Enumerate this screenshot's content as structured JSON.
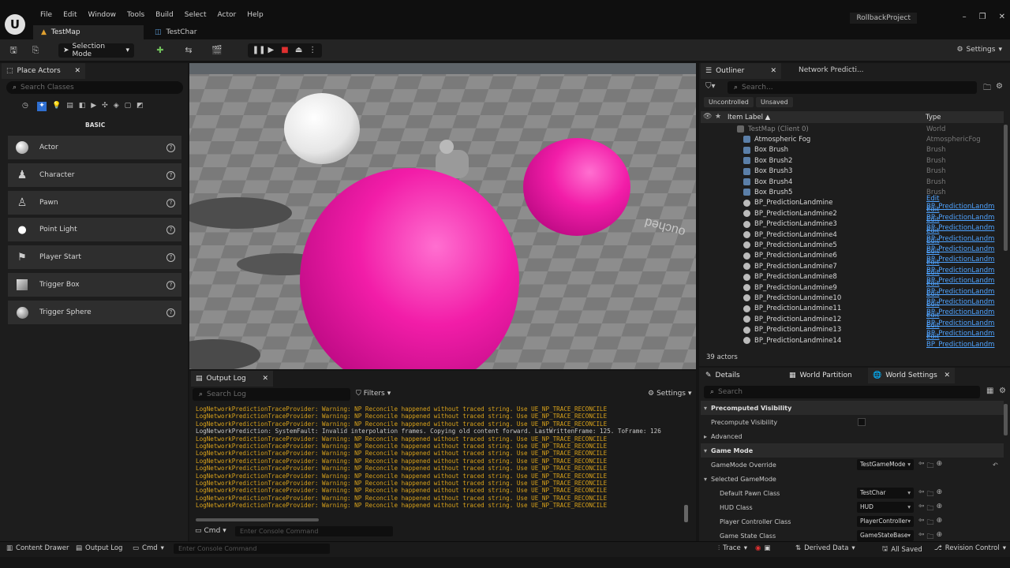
{
  "app": {
    "project": "RollbackProject",
    "menu": [
      "File",
      "Edit",
      "Window",
      "Tools",
      "Build",
      "Select",
      "Actor",
      "Help"
    ],
    "tabs": [
      {
        "label": "TestMap"
      },
      {
        "label": "TestChar"
      }
    ]
  },
  "toolbar": {
    "selection_mode": "Selection Mode",
    "settings": "Settings"
  },
  "place_actors": {
    "tab": "Place Actors",
    "search_placeholder": "Search Classes",
    "category": "BASIC",
    "items": [
      "Actor",
      "Character",
      "Pawn",
      "Point Light",
      "Player Start",
      "Trigger Box",
      "Trigger Sphere"
    ]
  },
  "viewport": {
    "floor_text": "ouched"
  },
  "outliner": {
    "tab": "Outliner",
    "tab2": "Network Predicti...",
    "search_placeholder": "Search...",
    "filter1": "Uncontrolled",
    "filter2": "Unsaved",
    "col_label": "Item Label ▲",
    "col_type": "Type",
    "rows": [
      {
        "name": "TestMap (Client 0)",
        "type": "World"
      },
      {
        "name": "Atmospheric Fog",
        "type": "AtmosphericFog"
      },
      {
        "name": "Box Brush",
        "type": "Brush"
      },
      {
        "name": "Box Brush2",
        "type": "Brush"
      },
      {
        "name": "Box Brush3",
        "type": "Brush"
      },
      {
        "name": "Box Brush4",
        "type": "Brush"
      },
      {
        "name": "Box Brush5",
        "type": "Brush"
      },
      {
        "name": "BP_PredictionLandmine",
        "type": "Edit BP_PredictionLandm"
      },
      {
        "name": "BP_PredictionLandmine2",
        "type": "Edit BP_PredictionLandm"
      },
      {
        "name": "BP_PredictionLandmine3",
        "type": "Edit BP_PredictionLandm"
      },
      {
        "name": "BP_PredictionLandmine4",
        "type": "Edit BP_PredictionLandm"
      },
      {
        "name": "BP_PredictionLandmine5",
        "type": "Edit BP_PredictionLandm"
      },
      {
        "name": "BP_PredictionLandmine6",
        "type": "Edit BP_PredictionLandm"
      },
      {
        "name": "BP_PredictionLandmine7",
        "type": "Edit BP_PredictionLandm"
      },
      {
        "name": "BP_PredictionLandmine8",
        "type": "Edit BP_PredictionLandm"
      },
      {
        "name": "BP_PredictionLandmine9",
        "type": "Edit BP_PredictionLandm"
      },
      {
        "name": "BP_PredictionLandmine10",
        "type": "Edit BP_PredictionLandm"
      },
      {
        "name": "BP_PredictionLandmine11",
        "type": "Edit BP_PredictionLandm"
      },
      {
        "name": "BP_PredictionLandmine12",
        "type": "Edit BP_PredictionLandm"
      },
      {
        "name": "BP_PredictionLandmine13",
        "type": "Edit BP_PredictionLandm"
      },
      {
        "name": "BP_PredictionLandmine14",
        "type": "Edit BP_PredictionLandm"
      }
    ],
    "count": "39 actors"
  },
  "output_log": {
    "tab": "Output Log",
    "search_placeholder": "Search Log",
    "filters": "Filters",
    "settings": "Settings",
    "lines": [
      "LogNetworkPredictionTraceProvider: Warning: NP Reconcile happened without traced string. Use UE_NP_TRACE_RECONCILE",
      "LogNetworkPredictionTraceProvider: Warning: NP Reconcile happened without traced string. Use UE_NP_TRACE_RECONCILE",
      "LogNetworkPredictionTraceProvider: Warning: NP Reconcile happened without traced string. Use UE_NP_TRACE_RECONCILE",
      "LogNetworkPrediction: SystemFault: Invalid interpolation frames. Copying old content forward. LastWrittenFrame: 125. ToFrame: 126",
      "LogNetworkPredictionTraceProvider: Warning: NP Reconcile happened without traced string. Use UE_NP_TRACE_RECONCILE",
      "LogNetworkPredictionTraceProvider: Warning: NP Reconcile happened without traced string. Use UE_NP_TRACE_RECONCILE",
      "LogNetworkPredictionTraceProvider: Warning: NP Reconcile happened without traced string. Use UE_NP_TRACE_RECONCILE",
      "LogNetworkPredictionTraceProvider: Warning: NP Reconcile happened without traced string. Use UE_NP_TRACE_RECONCILE",
      "LogNetworkPredictionTraceProvider: Warning: NP Reconcile happened without traced string. Use UE_NP_TRACE_RECONCILE",
      "LogNetworkPredictionTraceProvider: Warning: NP Reconcile happened without traced string. Use UE_NP_TRACE_RECONCILE",
      "LogNetworkPredictionTraceProvider: Warning: NP Reconcile happened without traced string. Use UE_NP_TRACE_RECONCILE",
      "LogNetworkPredictionTraceProvider: Warning: NP Reconcile happened without traced string. Use UE_NP_TRACE_RECONCILE",
      "LogNetworkPredictionTraceProvider: Warning: NP Reconcile happened without traced string. Use UE_NP_TRACE_RECONCILE",
      "LogNetworkPredictionTraceProvider: Warning: NP Reconcile happened without traced string. Use UE_NP_TRACE_RECONCILE"
    ],
    "cmd": "Cmd",
    "cmd_placeholder": "Enter Console Command"
  },
  "details": {
    "tab1": "Details",
    "tab2": "World Partition",
    "tab3": "World Settings",
    "search_placeholder": "Search",
    "rows": [
      {
        "label": "Precomputed Visibility",
        "kind": "section"
      },
      {
        "label": "Precompute Visibility",
        "kind": "check"
      },
      {
        "label": "Advanced",
        "kind": "collapsed"
      },
      {
        "label": "Game Mode",
        "kind": "section"
      },
      {
        "label": "GameMode Override",
        "kind": "combo",
        "value": "TestGameMode"
      },
      {
        "label": "Selected GameMode",
        "kind": "subsection"
      },
      {
        "label": "Default Pawn Class",
        "kind": "combo",
        "value": "TestChar"
      },
      {
        "label": "HUD Class",
        "kind": "combo",
        "value": "HUD"
      },
      {
        "label": "Player Controller Class",
        "kind": "combo",
        "value": "PlayerController"
      },
      {
        "label": "Game State Class",
        "kind": "combo",
        "value": "GameStateBase"
      }
    ]
  },
  "statusbar": {
    "content_drawer": "Content Drawer",
    "output_log": "Output Log",
    "cmd": "Cmd",
    "cmd_placeholder": "Enter Console Command",
    "trace": "Trace",
    "derived_data": "Derived Data",
    "saved": "All Saved",
    "revision": "Revision Control"
  }
}
